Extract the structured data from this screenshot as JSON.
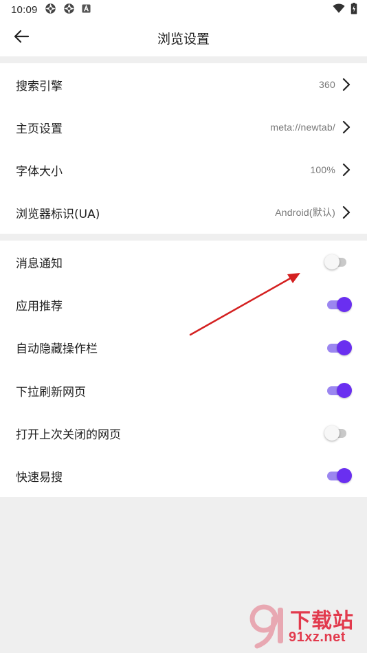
{
  "status_bar": {
    "time": "10:09",
    "icons_left": [
      "aperture-icon",
      "aperture-icon",
      "font-notification-icon"
    ],
    "icons_right": [
      "wifi-icon",
      "battery-icon"
    ]
  },
  "header": {
    "title": "浏览设置",
    "back_icon": "arrow-left-icon"
  },
  "group1": [
    {
      "label": "搜索引擎",
      "value": "360"
    },
    {
      "label": "主页设置",
      "value": "meta://newtab/"
    },
    {
      "label": "字体大小",
      "value": "100%"
    },
    {
      "label": "浏览器标识(UA)",
      "value": "Android(默认)"
    }
  ],
  "group2": [
    {
      "label": "消息通知",
      "on": false
    },
    {
      "label": "应用推荐",
      "on": true
    },
    {
      "label": "自动隐藏操作栏",
      "on": true
    },
    {
      "label": "下拉刷新网页",
      "on": true
    },
    {
      "label": "打开上次关闭的网页",
      "on": false
    },
    {
      "label": "快速易搜",
      "on": true
    }
  ],
  "colors": {
    "accent": "#6a2ff0",
    "accent_track": "#9b86f0",
    "annotation_arrow": "#d42020",
    "watermark": "#e23a4d"
  },
  "watermark": {
    "text": "下载站",
    "url": "91xz.net"
  }
}
